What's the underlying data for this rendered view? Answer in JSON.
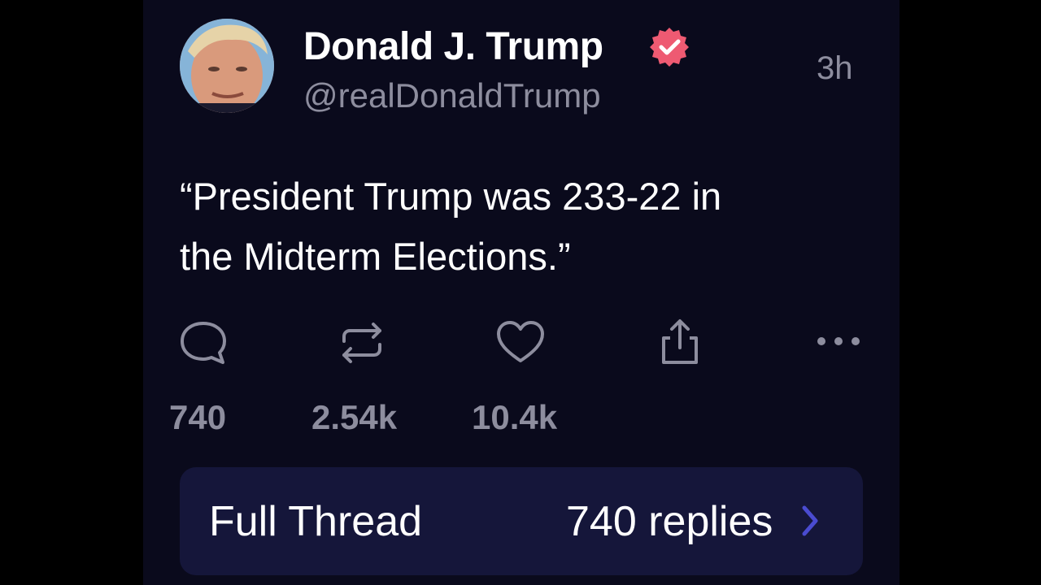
{
  "post": {
    "display_name": "Donald J. Trump",
    "handle": "@realDonaldTrump",
    "timestamp": "3h",
    "verified": true,
    "text": "“President Trump was 233-22 in\nthe Midterm Elections.”"
  },
  "actions": {
    "reply_count": "740",
    "repost_count": "2.54k",
    "like_count": "10.4k"
  },
  "thread": {
    "title": "Full Thread",
    "replies": "740 replies"
  },
  "colors": {
    "background": "#000000",
    "panel": "#0a0a1c",
    "verified_badge": "#ee5a72",
    "muted_text": "#8d8d9e",
    "thread_bar": "#15163a",
    "chevron": "#4a4bd0"
  }
}
